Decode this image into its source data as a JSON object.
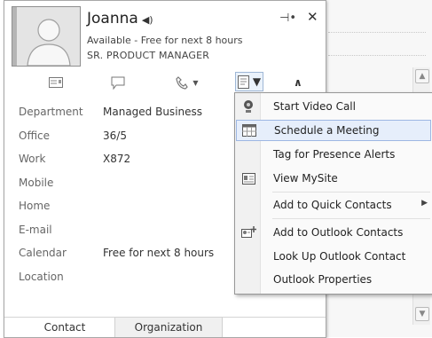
{
  "contact": {
    "name": "Joanna",
    "availability": "Available - Free for next 8 hours",
    "job_title": "SR. PRODUCT MANAGER",
    "presence_color": "#b5b5b5"
  },
  "details": [
    {
      "label": "Department",
      "value": "Managed Business"
    },
    {
      "label": "Office",
      "value": "36/5"
    },
    {
      "label": "Work",
      "value": "X872"
    },
    {
      "label": "Mobile",
      "value": ""
    },
    {
      "label": "Home",
      "value": ""
    },
    {
      "label": "E-mail",
      "value": ""
    },
    {
      "label": "Calendar",
      "value": "Free for next 8 hours"
    },
    {
      "label": "Location",
      "value": ""
    }
  ],
  "tabs": [
    "Contact",
    "Organization"
  ],
  "menu": {
    "items": [
      {
        "label": "Start Video Call",
        "icon": "video-camera-icon"
      },
      {
        "label": "Schedule a Meeting",
        "icon": "calendar-icon",
        "highlighted": true
      },
      {
        "label": "Tag for Presence Alerts",
        "icon": ""
      },
      {
        "label": "View MySite",
        "icon": "mysite-icon"
      },
      {
        "label": "Add to Quick Contacts",
        "icon": "",
        "submenu": true
      },
      {
        "label": "Add to Outlook Contacts",
        "icon": "add-contact-icon"
      },
      {
        "label": "Look Up Outlook Contact",
        "icon": ""
      },
      {
        "label": "Outlook Properties",
        "icon": ""
      }
    ]
  },
  "colors": {
    "menu_highlight": "#e6eefb",
    "menu_highlight_border": "#9db7e3"
  }
}
